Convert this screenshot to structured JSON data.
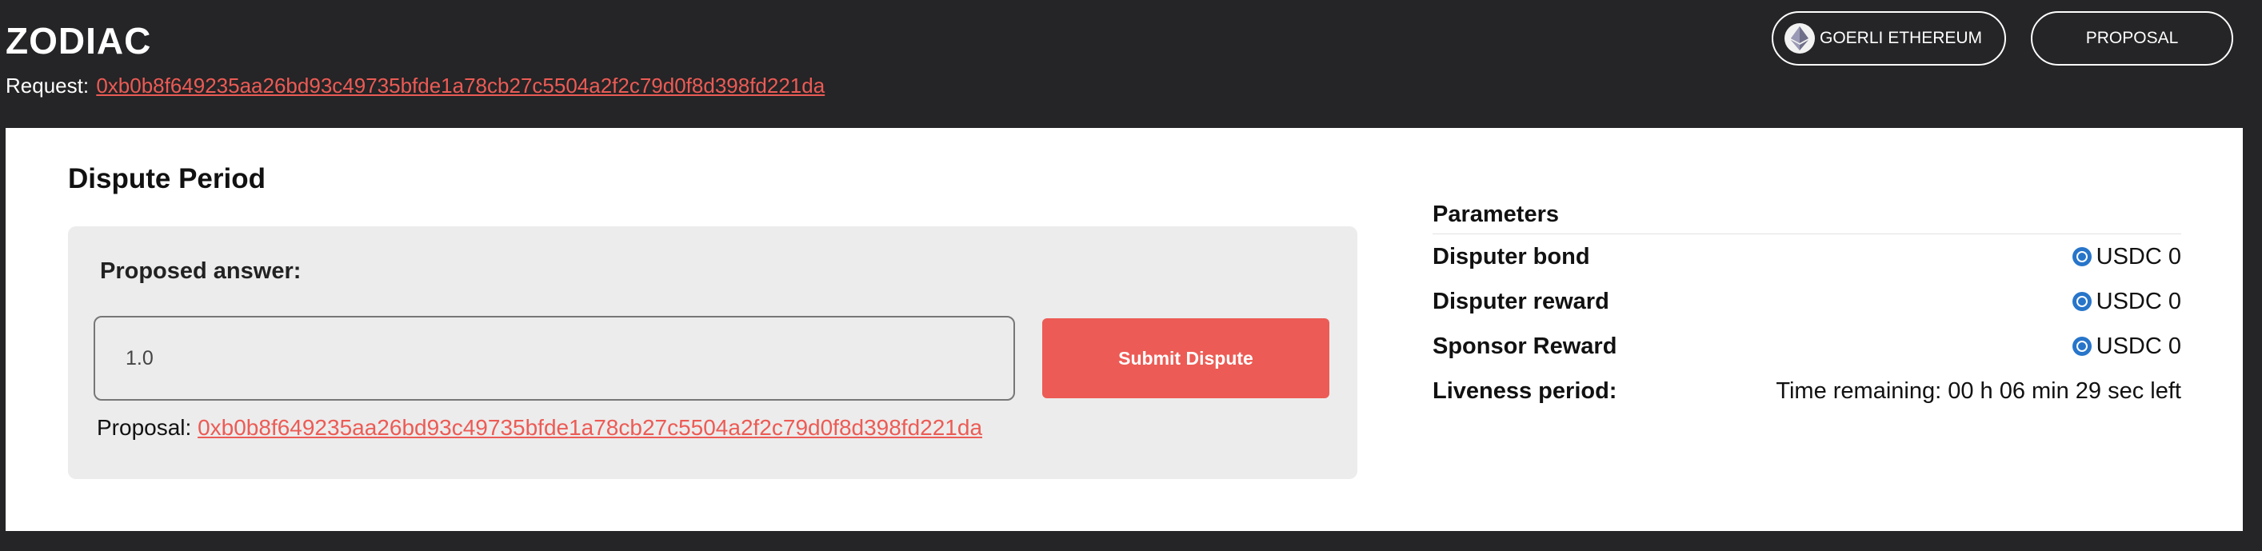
{
  "header": {
    "brand": "ZODIAC",
    "request_label": "Request:",
    "request_hash": "0xb0b8f649235aa26bd93c49735bfde1a78cb27c5504a2f2c79d0f8d398fd221da",
    "network_label": "GOERLI ETHEREUM",
    "proposal_button": "PROPOSAL"
  },
  "dispute": {
    "title": "Dispute Period",
    "answer_label": "Proposed answer:",
    "answer_value": "1.0",
    "submit_label": "Submit Dispute",
    "proposal_label": "Proposal:",
    "proposal_hash": "0xb0b8f649235aa26bd93c49735bfde1a78cb27c5504a2f2c79d0f8d398fd221da"
  },
  "parameters": {
    "title": "Parameters",
    "rows": [
      {
        "label": "Disputer bond",
        "value": "USDC 0",
        "icon": "usdc-icon"
      },
      {
        "label": "Disputer reward",
        "value": "USDC 0",
        "icon": "usdc-icon"
      },
      {
        "label": "Sponsor Reward",
        "value": "USDC 0",
        "icon": "usdc-icon"
      },
      {
        "label": "Liveness period:",
        "value": "Time remaining: 00 h 06 min 29 sec left"
      }
    ]
  },
  "colors": {
    "background": "#252426",
    "accent": "#ec5b55",
    "panel": "#ececec",
    "usdc": "#2775ca"
  }
}
